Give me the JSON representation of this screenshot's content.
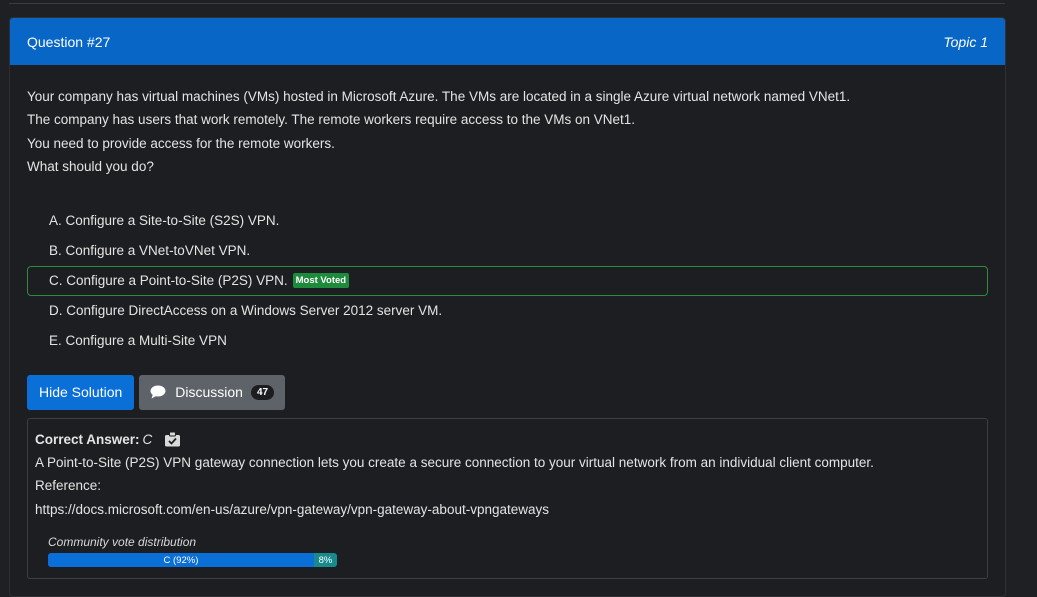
{
  "header": {
    "question_number": "Question #27",
    "topic": "Topic 1"
  },
  "question": {
    "paragraphs": [
      "Your company has virtual machines (VMs) hosted in Microsoft Azure. The VMs are located in a single Azure virtual network named VNet1.",
      "The company has users that work remotely. The remote workers require access to the VMs on VNet1.",
      "You need to provide access for the remote workers.",
      "What should you do?"
    ]
  },
  "choices": [
    {
      "text": "A. Configure a Site-to-Site (S2S) VPN."
    },
    {
      "text": "B. Configure a VNet-toVNet VPN."
    },
    {
      "text": "C. Configure a Point-to-Site (P2S) VPN.",
      "badge": "Most Voted"
    },
    {
      "text": "D. Configure DirectAccess on a Windows Server 2012 server VM."
    },
    {
      "text": "E. Configure a Multi-Site VPN"
    }
  ],
  "buttons": {
    "hide_solution": "Hide Solution",
    "discussion": "Discussion",
    "discussion_count": "47"
  },
  "answer": {
    "label": "Correct Answer:",
    "value": "C",
    "explanation": "A Point-to-Site (P2S) VPN gateway connection lets you create a secure connection to your virtual network from an individual client computer.",
    "reference_label": "Reference:",
    "reference_url": "https://docs.microsoft.com/en-us/azure/vpn-gateway/vpn-gateway-about-vpngateways"
  },
  "vote_distribution": {
    "title": "Community vote distribution",
    "segments": [
      {
        "label": "C (92%)",
        "percent": 92,
        "color": "#0b6fd8"
      },
      {
        "label": "8%",
        "percent": 8,
        "color": "#188a8d"
      }
    ]
  },
  "colors": {
    "header": "#0866c6",
    "correct_border": "#2e8b3e",
    "badge": "#1e8a3c",
    "primary_button": "#0b6fd8"
  }
}
